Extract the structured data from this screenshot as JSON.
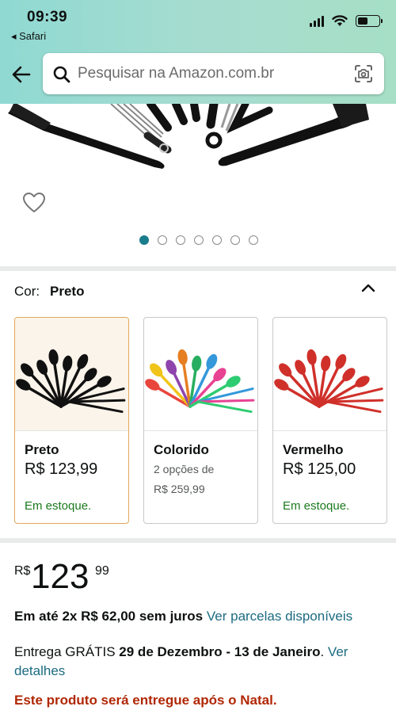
{
  "status_bar": {
    "time": "09:39",
    "back_app": "◂ Safari"
  },
  "search": {
    "placeholder": "Pesquisar na Amazon.com.br"
  },
  "icons": [
    "back-arrow-icon",
    "search-icon",
    "camera-scan-icon",
    "heart-icon",
    "chevron-up-icon",
    "signal-icon",
    "wifi-icon",
    "battery-icon"
  ],
  "gallery": {
    "dot_count": 7,
    "active_index": 0
  },
  "color_selector": {
    "label": "Cor:",
    "selected": "Preto"
  },
  "variants": [
    {
      "name": "Preto",
      "price": "R$ 123,99",
      "stock": "Em estoque.",
      "selected": true,
      "swatch": "#111111"
    },
    {
      "name": "Colorido",
      "options": "2 opções de",
      "price": "R$ 259,99",
      "selected": false
    },
    {
      "name": "Vermelho",
      "price": "R$ 125,00",
      "stock": "Em estoque.",
      "selected": false,
      "swatch": "#d0302a"
    }
  ],
  "price": {
    "currency": "R$",
    "whole": "123",
    "fraction": "99"
  },
  "installments": {
    "text": "Em até 2x R$ 62,00 sem juros",
    "link": "Ver parcelas disponíveis"
  },
  "delivery": {
    "prefix": "Entrega GRÁTIS",
    "dates": "29 de Dezembro - 13 de Janeiro",
    "suffix": ".",
    "link": "Ver detalhes"
  },
  "notice": "Este produto será entregue após o Natal.",
  "colors": {
    "link": "#1c6b81",
    "stock": "#1b7a1e",
    "notice": "#b12704",
    "accent_dot": "#1b7c8d",
    "selected_border": "#e0a85a"
  }
}
